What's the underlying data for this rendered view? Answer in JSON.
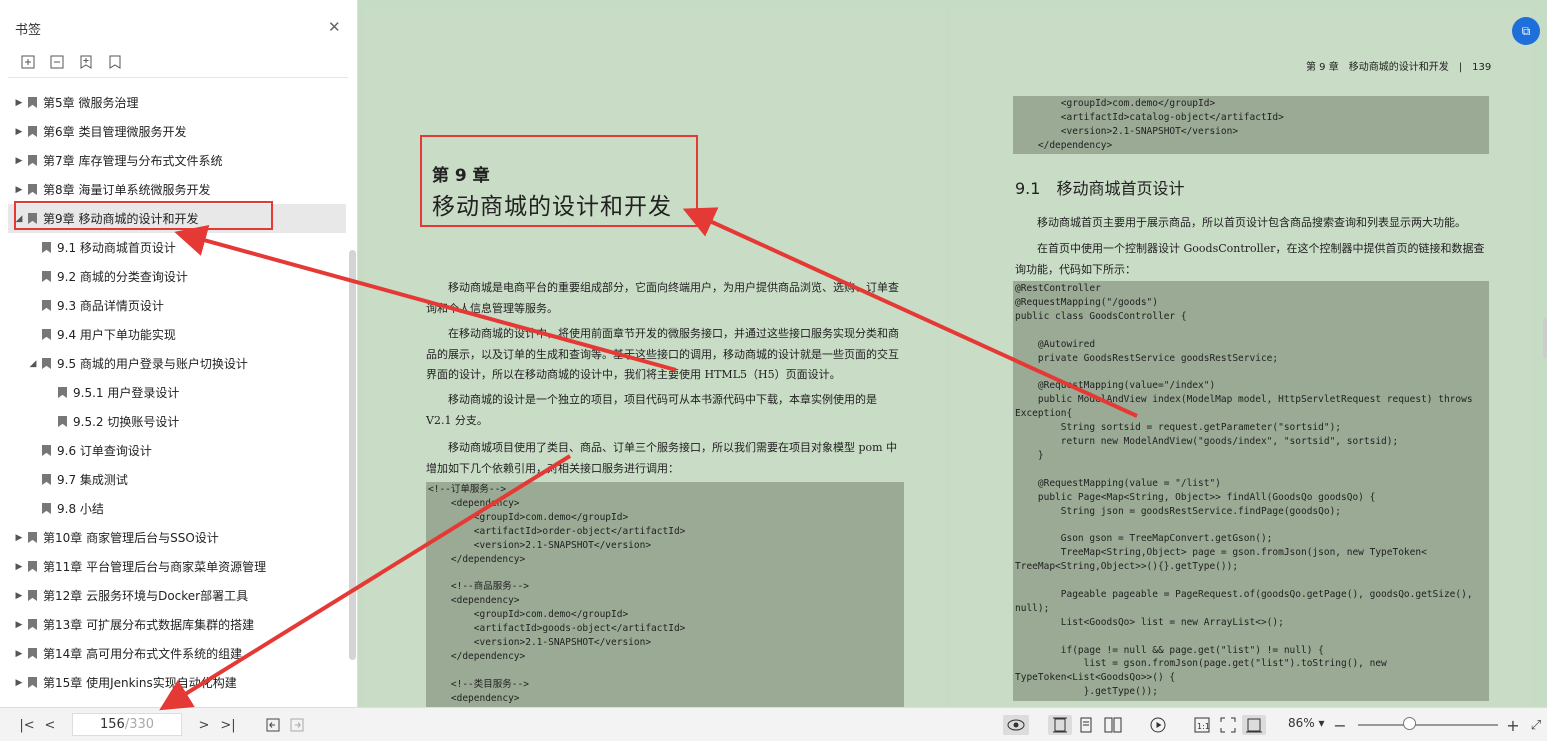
{
  "sidebar": {
    "title": "书签",
    "close_icon": "close-icon",
    "tool_icons": [
      "expand-all-icon",
      "collapse-all-icon",
      "add-bookmark-icon",
      "bookmark-icon"
    ],
    "items": [
      {
        "label": "第5章 微服务治理",
        "level": 0,
        "expandable": true
      },
      {
        "label": "第6章 类目管理微服务开发",
        "level": 0,
        "expandable": true
      },
      {
        "label": "第7章 库存管理与分布式文件系统",
        "level": 0,
        "expandable": true
      },
      {
        "label": "第8章 海量订单系统微服务开发",
        "level": 0,
        "expandable": true
      },
      {
        "label": "第9章 移动商城的设计和开发",
        "level": 0,
        "expandable": true,
        "expanded": true,
        "active": true
      },
      {
        "label": "9.1 移动商城首页设计",
        "level": 1
      },
      {
        "label": "9.2 商城的分类查询设计",
        "level": 1
      },
      {
        "label": "9.3 商品详情页设计",
        "level": 1
      },
      {
        "label": "9.4 用户下单功能实现",
        "level": 1
      },
      {
        "label": "9.5 商城的用户登录与账户切换设计",
        "level": 1,
        "expandable": true,
        "expanded": true
      },
      {
        "label": "9.5.1 用户登录设计",
        "level": 2
      },
      {
        "label": "9.5.2 切换账号设计",
        "level": 2
      },
      {
        "label": "9.6 订单查询设计",
        "level": 1
      },
      {
        "label": "9.7 集成测试",
        "level": 1
      },
      {
        "label": "9.8 小结",
        "level": 1
      },
      {
        "label": "第10章 商家管理后台与SSO设计",
        "level": 0,
        "expandable": true
      },
      {
        "label": "第11章 平台管理后台与商家菜单资源管理",
        "level": 0,
        "expandable": true
      },
      {
        "label": "第12章 云服务环境与Docker部署工具",
        "level": 0,
        "expandable": true
      },
      {
        "label": "第13章 可扩展分布式数据库集群的搭建",
        "level": 0,
        "expandable": true
      },
      {
        "label": "第14章 高可用分布式文件系统的组建",
        "level": 0,
        "expandable": true
      },
      {
        "label": "第15章 使用Jenkins实现自动化构建",
        "level": 0,
        "expandable": true
      }
    ]
  },
  "left_page": {
    "chapter_num": "第 9 章",
    "chapter_title": "移动商城的设计和开发",
    "paragraphs": [
      "移动商城是电商平台的重要组成部分，它面向终端用户，为用户提供商品浏览、选购、订单查询和个人信息管理等服务。",
      "在移动商城的设计中，将使用前面章节开发的微服务接口，并通过这些接口服务实现分类和商品的展示，以及订单的生成和查询等。基于这些接口的调用，移动商城的设计就是一些页面的交互界面的设计，所以在移动商城的设计中，我们将主要使用 HTML5（H5）页面设计。",
      "移动商城的设计是一个独立的项目，项目代码可从本书源代码中下载，本章实例使用的是 V2.1 分支。",
      "移动商城项目使用了类目、商品、订单三个服务接口，所以我们需要在项目对象模型 pom 中增加如下几个依赖引用，对相关接口服务进行调用："
    ],
    "code": "<!--订单服务-->\n    <dependency>\n        <groupId>com.demo</groupId>\n        <artifactId>order-object</artifactId>\n        <version>2.1-SNAPSHOT</version>\n    </dependency>\n\n    <!--商品服务-->\n    <dependency>\n        <groupId>com.demo</groupId>\n        <artifactId>goods-object</artifactId>\n        <version>2.1-SNAPSHOT</version>\n    </dependency>\n\n    <!--类目服务-->\n    <dependency>"
  },
  "right_page": {
    "header": "第 9 章　移动商城的设计和开发　|　139",
    "code_top": "        <groupId>com.demo</groupId>\n        <artifactId>catalog-object</artifactId>\n        <version>2.1-SNAPSHOT</version>\n    </dependency>",
    "section_title": "9.1　移动商城首页设计",
    "paragraphs": [
      "移动商城首页主要用于展示商品，所以首页设计包含商品搜索查询和列表显示两大功能。",
      "在首页中使用一个控制器设计 GoodsController，在这个控制器中提供首页的链接和数据查询功能，代码如下所示："
    ],
    "code": "@RestController\n@RequestMapping(\"/goods\")\npublic class GoodsController {\n\n    @Autowired\n    private GoodsRestService goodsRestService;\n\n    @RequestMapping(value=\"/index\")\n    public ModelAndView index(ModelMap model, HttpServletRequest request) throws\nException{\n        String sortsid = request.getParameter(\"sortsid\");\n        return new ModelAndView(\"goods/index\", \"sortsid\", sortsid);\n    }\n\n    @RequestMapping(value = \"/list\")\n    public Page<Map<String, Object>> findAll(GoodsQo goodsQo) {\n        String json = goodsRestService.findPage(goodsQo);\n\n        Gson gson = TreeMapConvert.getGson();\n        TreeMap<String,Object> page = gson.fromJson(json, new TypeToken<\nTreeMap<String,Object>>(){}.getType());\n\n        Pageable pageable = PageRequest.of(goodsQo.getPage(), goodsQo.getSize(),\nnull);\n        List<GoodsQo> list = new ArrayList<>();\n\n        if(page != null && page.get(\"list\") != null) {\n            list = gson.fromJson(page.get(\"list\").toString(), new\nTypeToken<List<GoodsQo>>() {\n            }.getType());"
  },
  "statusbar": {
    "current_page": "156",
    "total_pages": "/330",
    "zoom": "86%",
    "zoom_fraction": 0.37
  },
  "colors": {
    "annotation": "#e53935",
    "page_bg": "#c7dcc4",
    "code_bg": "#9aaa95",
    "accent": "#1e6fd9"
  }
}
